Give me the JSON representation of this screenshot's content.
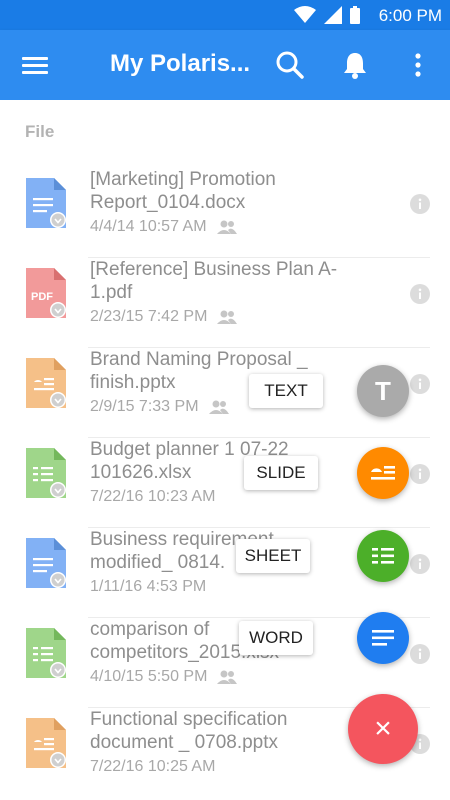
{
  "status_bar": {
    "time": "6:00 PM"
  },
  "app_bar": {
    "title": "My Polaris..."
  },
  "section": {
    "label": "File"
  },
  "files": [
    {
      "name": "[Marketing] Promotion Report_0104.docx",
      "date": "4/4/14 10:57 AM",
      "type": "docx",
      "color": "#82b1f5"
    },
    {
      "name": "[Reference] Business Plan A-1.pdf",
      "date": "2/23/15 7:42 PM",
      "type": "pdf",
      "color": "#f29a9a",
      "badge": "PDF"
    },
    {
      "name": "Brand Naming Proposal _ finish.pptx",
      "date": "2/9/15 7:33 PM",
      "type": "pptx",
      "color": "#f5c088"
    },
    {
      "name": "Budget planner 1 07-22 101626.xlsx",
      "date": "7/22/16 10:23 AM",
      "type": "xlsx",
      "color": "#9fd68a"
    },
    {
      "name": "Business requirement modified_ 0814.",
      "date": "1/11/16 4:53 PM",
      "type": "docx",
      "color": "#82b1f5"
    },
    {
      "name": "comparison of competitors_2015.xlsx",
      "date": "4/10/15 5:50 PM",
      "type": "xlsx",
      "color": "#9fd68a"
    },
    {
      "name": "Functional specification document _ 0708.pptx",
      "date": "7/22/16 10:25 AM",
      "type": "pptx",
      "color": "#f5c088"
    }
  ],
  "fab_menu": [
    {
      "label": "TEXT",
      "glyph": "T",
      "color": "#aaaaaa"
    },
    {
      "label": "SLIDE",
      "color": "#ff8a00"
    },
    {
      "label": "SHEET",
      "color": "#4caf29"
    },
    {
      "label": "WORD",
      "color": "#1f7df0"
    }
  ],
  "fab_close": {
    "glyph": "×",
    "color": "#f4555e"
  }
}
